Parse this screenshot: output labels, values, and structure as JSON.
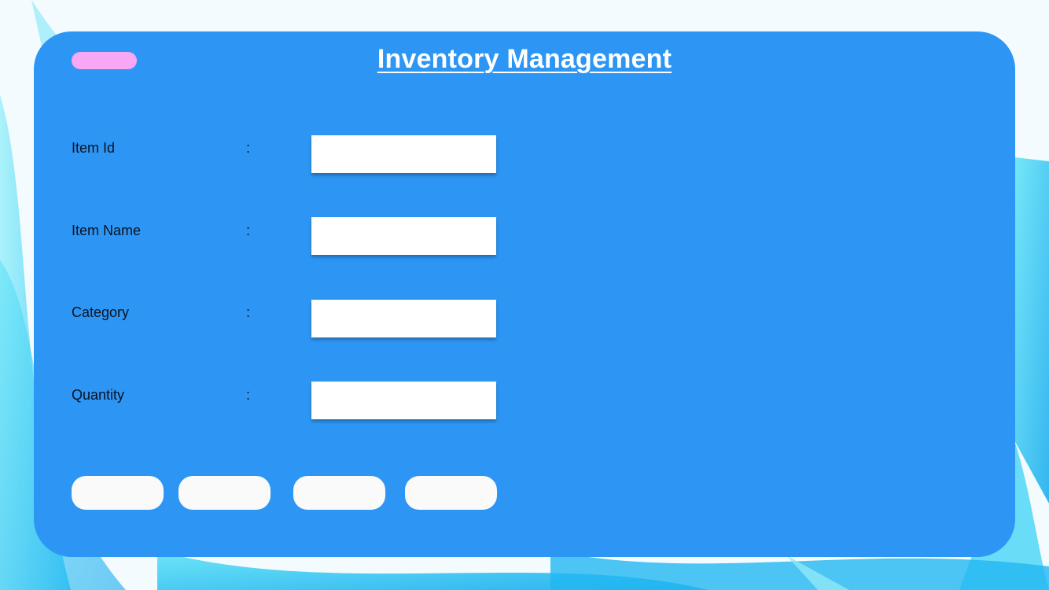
{
  "app": {
    "title": "Inventory Management"
  },
  "form": {
    "separator": ":",
    "fields": [
      {
        "label": "Item Id",
        "value": ""
      },
      {
        "label": "Item Name",
        "value": ""
      },
      {
        "label": "Category",
        "value": ""
      },
      {
        "label": "Quantity",
        "value": ""
      }
    ]
  },
  "actions": {
    "buttons": [
      {
        "label": ""
      },
      {
        "label": ""
      },
      {
        "label": ""
      },
      {
        "label": ""
      }
    ]
  },
  "colors": {
    "panel": "#2d96f4",
    "accent_pill": "#f8a7f5",
    "button": "#fafafa",
    "text": "#0d1220",
    "title": "#ffffff"
  }
}
